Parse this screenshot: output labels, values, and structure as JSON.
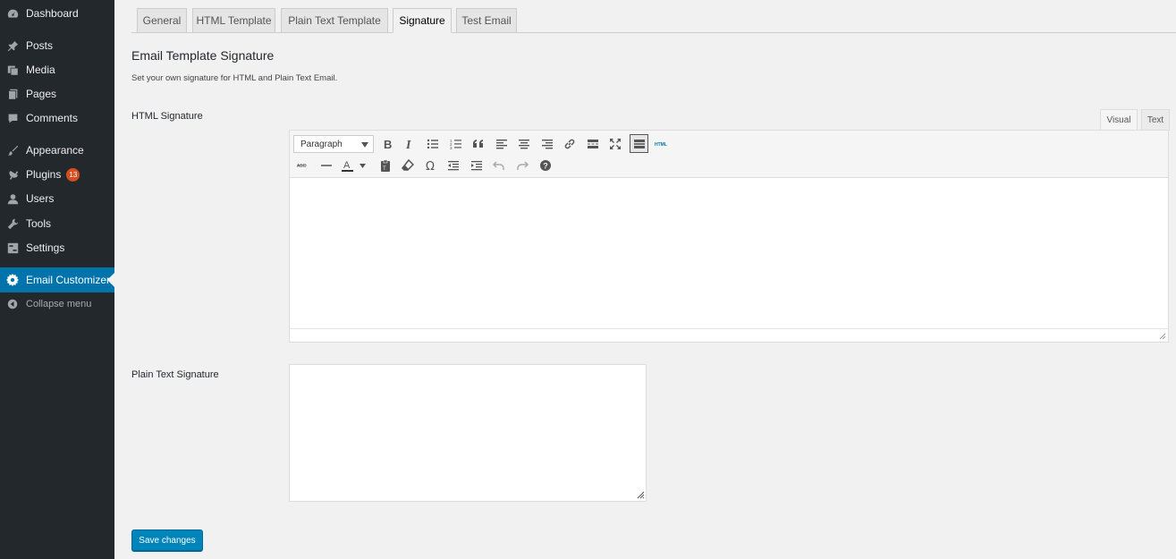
{
  "sidebar": {
    "items": [
      {
        "label": "Dashboard",
        "icon": "dashboard-icon"
      },
      {
        "label": "Posts",
        "icon": "pin-icon"
      },
      {
        "label": "Media",
        "icon": "media-icon"
      },
      {
        "label": "Pages",
        "icon": "pages-icon"
      },
      {
        "label": "Comments",
        "icon": "comment-icon"
      },
      {
        "label": "Appearance",
        "icon": "brush-icon"
      },
      {
        "label": "Plugins",
        "icon": "plugin-icon",
        "badge": "13"
      },
      {
        "label": "Users",
        "icon": "user-icon"
      },
      {
        "label": "Tools",
        "icon": "wrench-icon"
      },
      {
        "label": "Settings",
        "icon": "settings-icon"
      },
      {
        "label": "Email Customizer",
        "icon": "gear-icon",
        "active": true
      },
      {
        "label": "Collapse menu",
        "icon": "collapse-icon"
      }
    ]
  },
  "tabs": [
    {
      "label": "General"
    },
    {
      "label": "HTML Template"
    },
    {
      "label": "Plain Text Template"
    },
    {
      "label": "Signature",
      "active": true
    },
    {
      "label": "Test Email"
    }
  ],
  "section": {
    "title": "Email Template Signature",
    "description": "Set your own signature for HTML and Plain Text Email."
  },
  "html_signature": {
    "label": "HTML Signature",
    "editor_tabs": {
      "visual": "Visual",
      "text": "Text"
    },
    "format_select": "Paragraph",
    "content": ""
  },
  "plain_signature": {
    "label": "Plain Text Signature",
    "value": ""
  },
  "save_button": "Save changes",
  "colors": {
    "sidebar_bg": "#23282d",
    "active_menu": "#0073aa",
    "badge": "#d54e21",
    "primary_button": "#0085ba"
  }
}
